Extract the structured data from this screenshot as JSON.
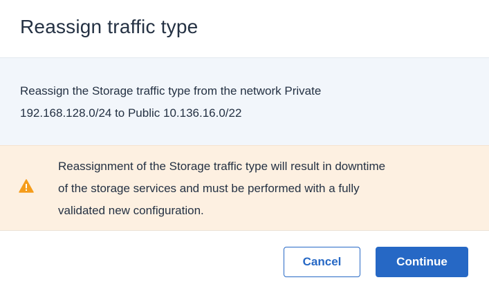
{
  "dialog": {
    "title": "Reassign traffic type",
    "info_line1": "Reassign the Storage traffic type from the network Private",
    "info_line2": "192.168.128.0/24 to Public 10.136.16.0/22",
    "warning_line1": "Reassignment of the Storage traffic type will result in downtime",
    "warning_line2": "of the storage services and must be performed with a fully",
    "warning_line3": "validated new configuration.",
    "warning_icon": "warning-triangle-icon",
    "cancel_label": "Cancel",
    "continue_label": "Continue"
  },
  "colors": {
    "accent": "#2668c5",
    "warning_bg": "#fdf0e1",
    "warning_icon": "#f59c1a",
    "info_bg": "#f2f6fb",
    "text": "#243143"
  }
}
